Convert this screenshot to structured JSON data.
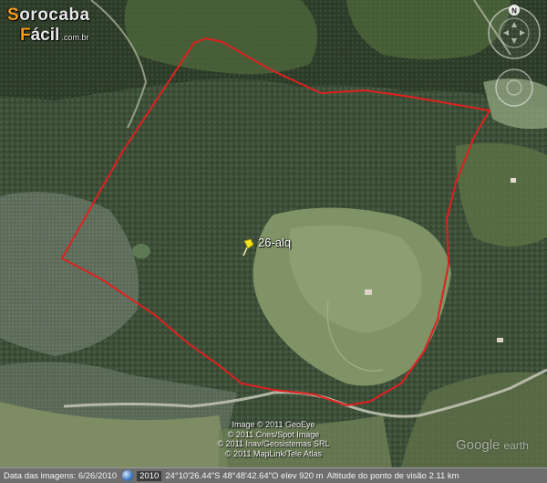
{
  "logo": {
    "first_letter": "S",
    "rest_line1": "orocaba",
    "second_initial": "F",
    "rest_line2": "ácil",
    "suffix": ".com.br"
  },
  "placemark": {
    "label": "26-alq"
  },
  "attribution": {
    "lines": [
      "Image © 2011 GeoEye",
      "© 2011 Cnes/Spot Image",
      "© 2011 Inav/Geosistemas SRL",
      "© 2011 MapLink/Tele Atlas"
    ]
  },
  "watermark": {
    "brand": "Google",
    "product": "earth"
  },
  "compass": {
    "north": "N"
  },
  "status_bar": {
    "imagery_date": "Data das imagens: 6/26/2010",
    "year": "2010",
    "coordinates": "24°10'26.44\"S  48°48'42.64\"O  elev  920 m",
    "eye_altitude": "Altitude do ponto de visão    2.11 km"
  },
  "colors": {
    "boundary": "#e0201f",
    "pin": "#f5e21b"
  }
}
